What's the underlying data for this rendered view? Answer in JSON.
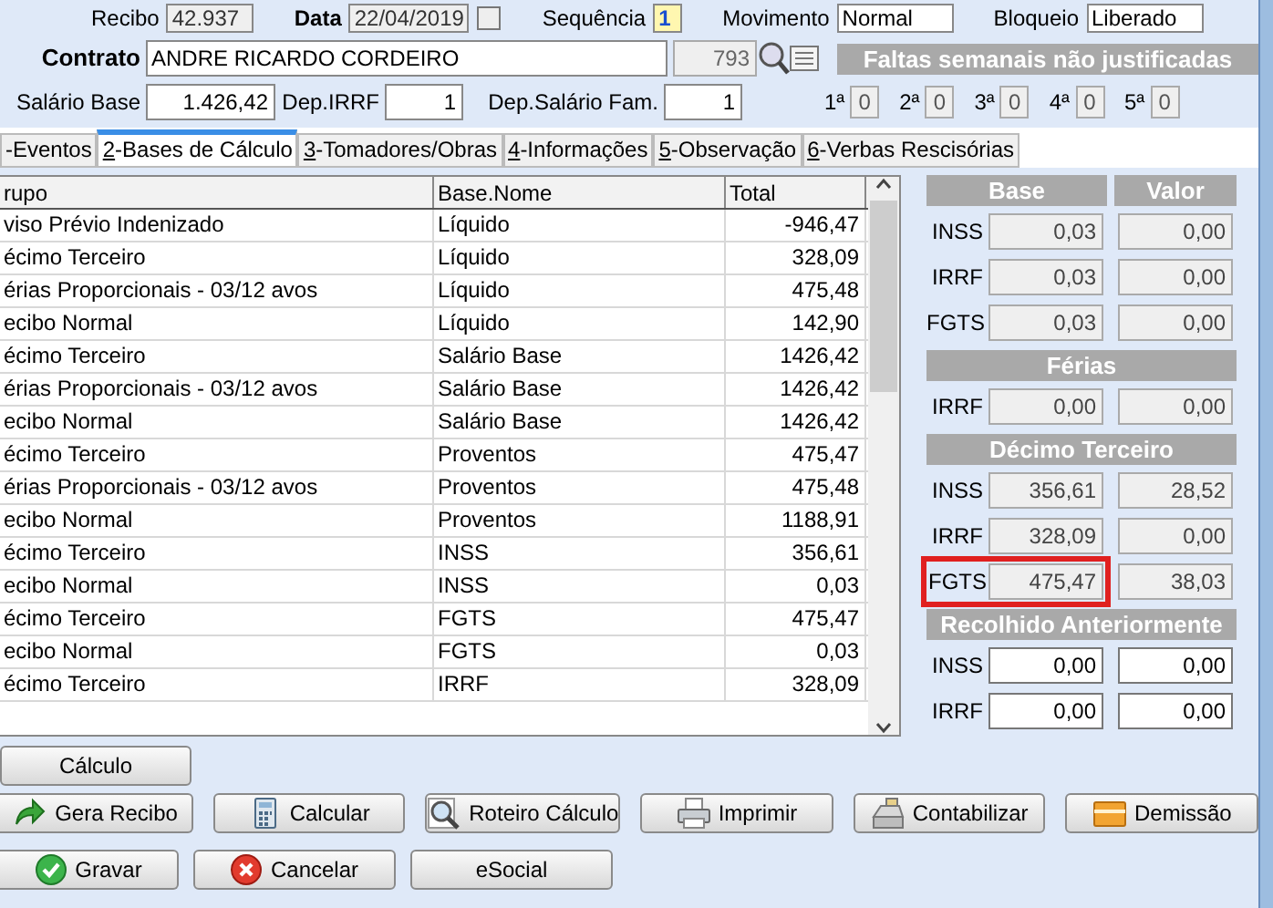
{
  "top_row": [
    {
      "label": "Recibo",
      "value": "42.937",
      "kind": "text"
    },
    {
      "label": "Data",
      "value": "22/04/2019",
      "kind": "date"
    },
    {
      "label": "Sequência",
      "value": "1",
      "kind": "seq"
    },
    {
      "label": "Movimento",
      "value": "Normal",
      "kind": "select"
    },
    {
      "label": "Bloqueio",
      "value": "Liberado",
      "kind": "select"
    }
  ],
  "contrato": {
    "label": "Contrato",
    "name": "ANDRE RICARDO CORDEIRO",
    "code": "793"
  },
  "salario_row": [
    {
      "label": "Salário Base",
      "value": "1.426,42"
    },
    {
      "label": "Dep.IRRF",
      "value": "1"
    },
    {
      "label": "Dep.Salário Fam.",
      "value": "1"
    }
  ],
  "faltas": {
    "title": "Faltas semanais não justificadas",
    "weeks": [
      {
        "label": "1ª",
        "value": "0"
      },
      {
        "label": "2ª",
        "value": "0"
      },
      {
        "label": "3ª",
        "value": "0"
      },
      {
        "label": "4ª",
        "value": "0"
      },
      {
        "label": "5ª",
        "value": "0"
      }
    ]
  },
  "tabs": [
    {
      "label": "-Eventos",
      "selected": false
    },
    {
      "key": "2",
      "label": "-Bases de Cálculo",
      "selected": true
    },
    {
      "key": "3",
      "label": "-Tomadores/Obras",
      "selected": false
    },
    {
      "key": "4",
      "label": "-Informações",
      "selected": false
    },
    {
      "key": "5",
      "label": "-Observação",
      "selected": false
    },
    {
      "key": "6",
      "label": "-Verbas Rescisórias",
      "selected": false
    }
  ],
  "table": {
    "columns": [
      "rupo",
      "Base.Nome",
      "Total"
    ],
    "rows": [
      [
        "viso Prévio Indenizado",
        "Líquido",
        "-946,47"
      ],
      [
        "écimo Terceiro",
        "Líquido",
        "328,09"
      ],
      [
        "érias Proporcionais - 03/12 avos",
        "Líquido",
        "475,48"
      ],
      [
        "ecibo Normal",
        "Líquido",
        "142,90"
      ],
      [
        "écimo Terceiro",
        "Salário Base",
        "1426,42"
      ],
      [
        "érias Proporcionais - 03/12 avos",
        "Salário Base",
        "1426,42"
      ],
      [
        "ecibo Normal",
        "Salário Base",
        "1426,42"
      ],
      [
        "écimo Terceiro",
        "Proventos",
        "475,47"
      ],
      [
        "érias Proporcionais - 03/12 avos",
        "Proventos",
        "475,48"
      ],
      [
        "ecibo Normal",
        "Proventos",
        "1188,91"
      ],
      [
        "écimo Terceiro",
        "INSS",
        "356,61"
      ],
      [
        "ecibo Normal",
        "INSS",
        "0,03"
      ],
      [
        "écimo Terceiro",
        "FGTS",
        "475,47"
      ],
      [
        "ecibo Normal",
        "FGTS",
        "0,03"
      ],
      [
        "écimo Terceiro",
        "IRRF",
        "328,09"
      ]
    ]
  },
  "bases_panel": {
    "columns": [
      "Base",
      "Valor"
    ],
    "sections": [
      {
        "rows": [
          {
            "label": "INSS",
            "base": "0,03",
            "valor": "0,00",
            "editable": false,
            "highlighted": false
          },
          {
            "label": "IRRF",
            "base": "0,03",
            "valor": "0,00",
            "editable": false,
            "highlighted": false
          },
          {
            "label": "FGTS",
            "base": "0,03",
            "valor": "0,00",
            "editable": false,
            "highlighted": false
          }
        ]
      },
      {
        "title": "Férias",
        "rows": [
          {
            "label": "IRRF",
            "base": "0,00",
            "valor": "0,00",
            "editable": false,
            "highlighted": false
          }
        ]
      },
      {
        "title": "Décimo Terceiro",
        "rows": [
          {
            "label": "INSS",
            "base": "356,61",
            "valor": "28,52",
            "editable": false,
            "highlighted": false
          },
          {
            "label": "IRRF",
            "base": "328,09",
            "valor": "0,00",
            "editable": false,
            "highlighted": false
          },
          {
            "label": "FGTS",
            "base": "475,47",
            "valor": "38,03",
            "editable": false,
            "highlighted": true
          }
        ]
      },
      {
        "title": "Recolhido Anteriormente",
        "rows": [
          {
            "label": "INSS",
            "base": "0,00",
            "valor": "0,00",
            "editable": true,
            "highlighted": false
          },
          {
            "label": "IRRF",
            "base": "0,00",
            "valor": "0,00",
            "editable": true,
            "highlighted": false
          }
        ]
      }
    ]
  },
  "calculo_button": "Cálculo",
  "action_buttons": [
    "Gera Recibo",
    "Calcular",
    "Roteiro Cálculo",
    "Imprimir",
    "Contabilizar",
    "Demissão"
  ],
  "footer_buttons": [
    "Gravar",
    "Cancelar",
    "eSocial"
  ]
}
